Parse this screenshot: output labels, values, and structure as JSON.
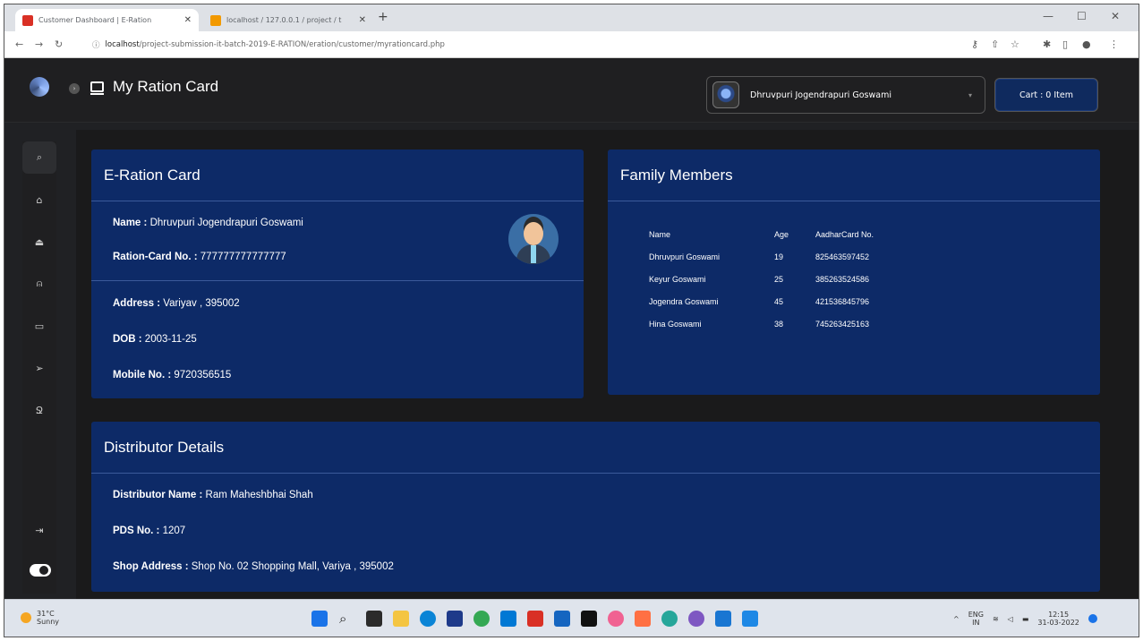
{
  "browser": {
    "tabs": [
      {
        "label": "Customer Dashboard | E-Ration",
        "fav_color": "#d93025"
      },
      {
        "label": "localhost / 127.0.0.1 / project / t",
        "fav_color": "#f29900"
      }
    ],
    "url_host": "localhost",
    "url_path": "/project-submission-it-batch-2019-E-RATION/eration/customer/myrationcard.php"
  },
  "app": {
    "page_title": "My Ration Card",
    "user_name": "Dhruvpuri Jogendrapuri Goswami",
    "cart_label": "Cart : 0 Item"
  },
  "sidebar": {
    "items": [
      {
        "icon": "search-icon",
        "glyph": "🔍"
      },
      {
        "icon": "home-icon",
        "glyph": "⌂"
      },
      {
        "icon": "bank-icon",
        "glyph": "⌂"
      },
      {
        "icon": "bell-icon",
        "glyph": "♫"
      },
      {
        "icon": "monitor-icon",
        "glyph": "▭"
      },
      {
        "icon": "cursor-icon",
        "glyph": "➤"
      },
      {
        "icon": "user-icon",
        "glyph": "☺"
      }
    ],
    "logout_icon": "logout-icon"
  },
  "ration_card": {
    "title": "E-Ration Card",
    "name_label": "Name :",
    "name_value": "Dhruvpuri Jogendrapuri Goswami",
    "card_label": "Ration-Card No. :",
    "card_value": "777777777777777",
    "address_label": "Address :",
    "address_value": "Variyav , 395002",
    "dob_label": "DOB :",
    "dob_value": "2003-11-25",
    "mobile_label": "Mobile No. :",
    "mobile_value": "9720356515"
  },
  "family": {
    "title": "Family Members",
    "columns": [
      "Name",
      "Age",
      "AadharCard No."
    ],
    "rows": [
      [
        "Dhruvpuri Goswami",
        "19",
        "825463597452"
      ],
      [
        "Keyur Goswami",
        "25",
        "385263524586"
      ],
      [
        "Jogendra Goswami",
        "45",
        "421536845796"
      ],
      [
        "Hina Goswami",
        "38",
        "745263425163"
      ]
    ]
  },
  "distributor": {
    "title": "Distributor Details",
    "name_label": "Distributor Name :",
    "name_value": "Ram Maheshbhai Shah",
    "pds_label": "PDS No. :",
    "pds_value": "1207",
    "shop_label": "Shop Address :",
    "shop_value": "Shop No. 02 Shopping Mall, Variya , 395002"
  },
  "taskbar": {
    "weather_temp": "31°C",
    "weather_desc": "Sunny",
    "lang": "ENG",
    "region": "IN",
    "time": "12:15",
    "date": "31-03-2022"
  },
  "colors": {
    "card_bg": "#0d2a67",
    "app_bg": "#1a1a1b",
    "topbar_bg": "#1f1f21"
  }
}
